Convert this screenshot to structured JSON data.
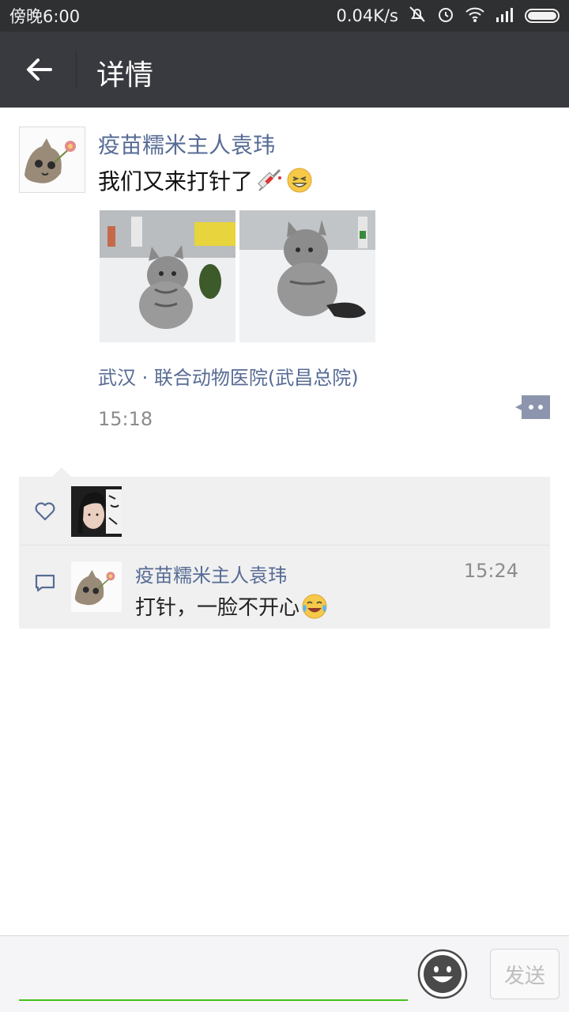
{
  "status_bar": {
    "time": "傍晚6:00",
    "net_speed": "0.04K/s",
    "icons": [
      "mute-icon",
      "alarm-icon",
      "wifi-icon",
      "signal-icon",
      "battery-icon"
    ]
  },
  "nav": {
    "title": "详情",
    "back_icon": "back-arrow-icon"
  },
  "post": {
    "author": "疫苗糯米主人袁玮",
    "text": "我们又来打针了",
    "text_emojis": [
      "syringe-emoji",
      "grin-emoji"
    ],
    "photos": [
      "kitten-on-table-photo-1",
      "kitten-on-table-photo-2"
    ],
    "location": "武汉 · 联合动物医院(武昌总院)",
    "time": "15:18"
  },
  "likes": {
    "icon": "heart-icon"
  },
  "comments": [
    {
      "author": "疫苗糯米主人袁玮",
      "time": "15:24",
      "text": "打针，一脸不开心",
      "emoji": "tears-of-joy-emoji"
    }
  ],
  "input_bar": {
    "placeholder": "",
    "send_label": "发送"
  },
  "colors": {
    "link": "#576b95",
    "nav_bg": "#393a3f",
    "status_bg": "#2f3032",
    "accent_green": "#45c01a"
  }
}
